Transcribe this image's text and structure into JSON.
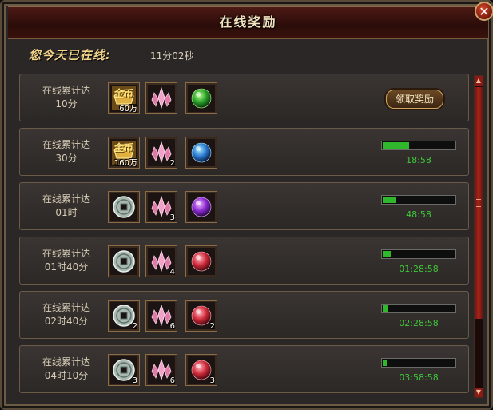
{
  "window": {
    "title": "在线奖励",
    "close_glyph": "✕"
  },
  "online": {
    "label": "您今天已在线:",
    "value": "11分02秒"
  },
  "colors": {
    "progress_fill": "#2fb82c",
    "timer_text": "#3fc83a",
    "title_text": "#f3e2c0"
  },
  "rewards": [
    {
      "label_line1": "在线累计达",
      "label_line2": "10分",
      "items": [
        {
          "icon": "gold-ingot-icon",
          "text": "金币",
          "qty": "60万"
        },
        {
          "icon": "pink-crystal-icon",
          "qty": ""
        },
        {
          "icon": "green-orb-icon",
          "qty": ""
        }
      ],
      "claim_label": "领取奖励"
    },
    {
      "label_line1": "在线累计达",
      "label_line2": "30分",
      "items": [
        {
          "icon": "gold-ingot-icon",
          "text": "金币",
          "qty": "160万"
        },
        {
          "icon": "pink-crystal-icon",
          "qty": "2"
        },
        {
          "icon": "blue-orb-icon",
          "qty": ""
        }
      ],
      "progress": 0.37,
      "timer": "18:58"
    },
    {
      "label_line1": "在线累计达",
      "label_line2": "01时",
      "items": [
        {
          "icon": "silver-coin-icon",
          "qty": ""
        },
        {
          "icon": "pink-crystal-icon",
          "qty": "3"
        },
        {
          "icon": "purple-orb-icon",
          "qty": ""
        }
      ],
      "progress": 0.18,
      "timer": "48:58"
    },
    {
      "label_line1": "在线累计达",
      "label_line2": "01时40分",
      "items": [
        {
          "icon": "silver-coin-icon",
          "qty": ""
        },
        {
          "icon": "pink-crystal-icon",
          "qty": "4"
        },
        {
          "icon": "red-orb-icon",
          "qty": ""
        }
      ],
      "progress": 0.11,
      "timer": "01:28:58"
    },
    {
      "label_line1": "在线累计达",
      "label_line2": "02时40分",
      "items": [
        {
          "icon": "silver-coin-icon",
          "qty": "2"
        },
        {
          "icon": "pink-crystal-icon",
          "qty": "6"
        },
        {
          "icon": "red-orb-icon",
          "qty": "2"
        }
      ],
      "progress": 0.07,
      "timer": "02:28:58"
    },
    {
      "label_line1": "在线累计达",
      "label_line2": "04时10分",
      "items": [
        {
          "icon": "silver-coin-icon",
          "qty": "3"
        },
        {
          "icon": "pink-crystal-icon",
          "qty": "6"
        },
        {
          "icon": "red-orb-icon",
          "qty": "3"
        }
      ],
      "progress": 0.05,
      "timer": "03:58:58"
    }
  ]
}
